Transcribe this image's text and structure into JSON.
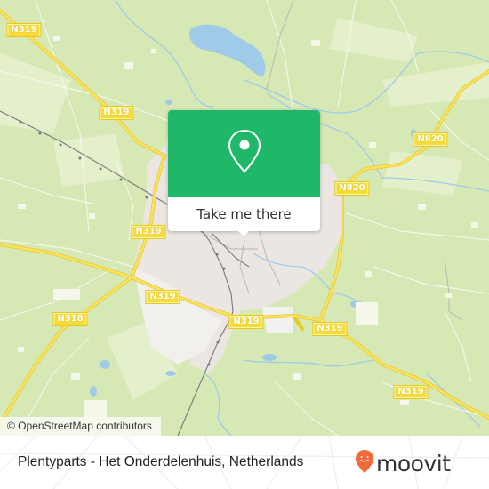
{
  "map": {
    "colors": {
      "land": "#d6e8b4",
      "urban": "#ebe6e1",
      "water": "#9fcbe8",
      "road_major": "#f3d64a",
      "rail": "#7a7a7a",
      "accent": "#1fb868"
    },
    "road_labels": [
      {
        "id": "n319-nw",
        "text": "N319"
      },
      {
        "id": "n319-mid",
        "text": "N319"
      },
      {
        "id": "n319-west",
        "text": "N319"
      },
      {
        "id": "n319-south",
        "text": "N319"
      },
      {
        "id": "n319-center",
        "text": "N319"
      },
      {
        "id": "n319-se1",
        "text": "N319"
      },
      {
        "id": "n319-se2",
        "text": "N319"
      },
      {
        "id": "n318",
        "text": "N318"
      },
      {
        "id": "n820-ne",
        "text": "N820"
      },
      {
        "id": "n820-mid",
        "text": "N820"
      }
    ],
    "attribution": "© OpenStreetMap contributors"
  },
  "popup": {
    "icon": "map-pin-icon",
    "button_label": "Take me there"
  },
  "footer": {
    "place_name": "Plentyparts - Het Onderdelenhuis, Netherlands",
    "brand_name": "moovit",
    "brand_icon": "moovit-smile-pin-icon",
    "brand_color": "#f26a3a"
  }
}
